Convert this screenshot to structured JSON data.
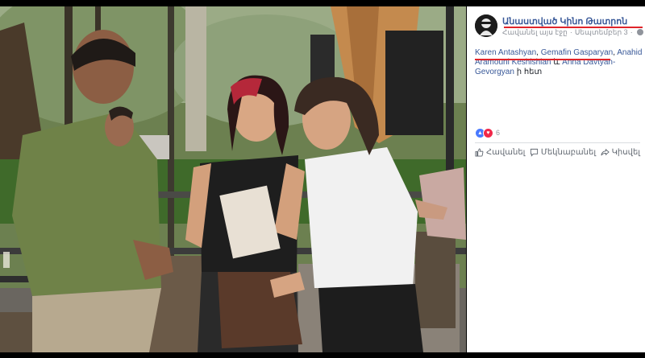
{
  "post": {
    "page_name": "Անաստված Կինո Թատրոն",
    "meta_like": "Հավանել այս էջը",
    "meta_separator": "·",
    "meta_date": "Սեպտեմբեր 3",
    "caption_tags": [
      "Karen Antashyan",
      "Gemafin Gasparyan",
      "Anahid Aramouni Keshishian",
      "Anna Davtyan-Gevorgyan"
    ],
    "caption_sep1": ", ",
    "caption_sep2": ", ",
    "caption_sep3": " և ",
    "caption_tail": " ի հետ",
    "reaction_count": "6"
  },
  "actions": {
    "like_label": "Հավանել",
    "comment_label": "Մեկնաբանել",
    "share_label": "Կիսվել"
  },
  "colors": {
    "link": "#385898",
    "annotation_red": "#e0242a",
    "like_blue": "#4a7aff",
    "love_red": "#f0284a"
  },
  "icons": [
    "globe-icon",
    "like-reaction-icon",
    "love-reaction-icon",
    "thumbs-up-icon",
    "comment-icon",
    "share-icon"
  ]
}
